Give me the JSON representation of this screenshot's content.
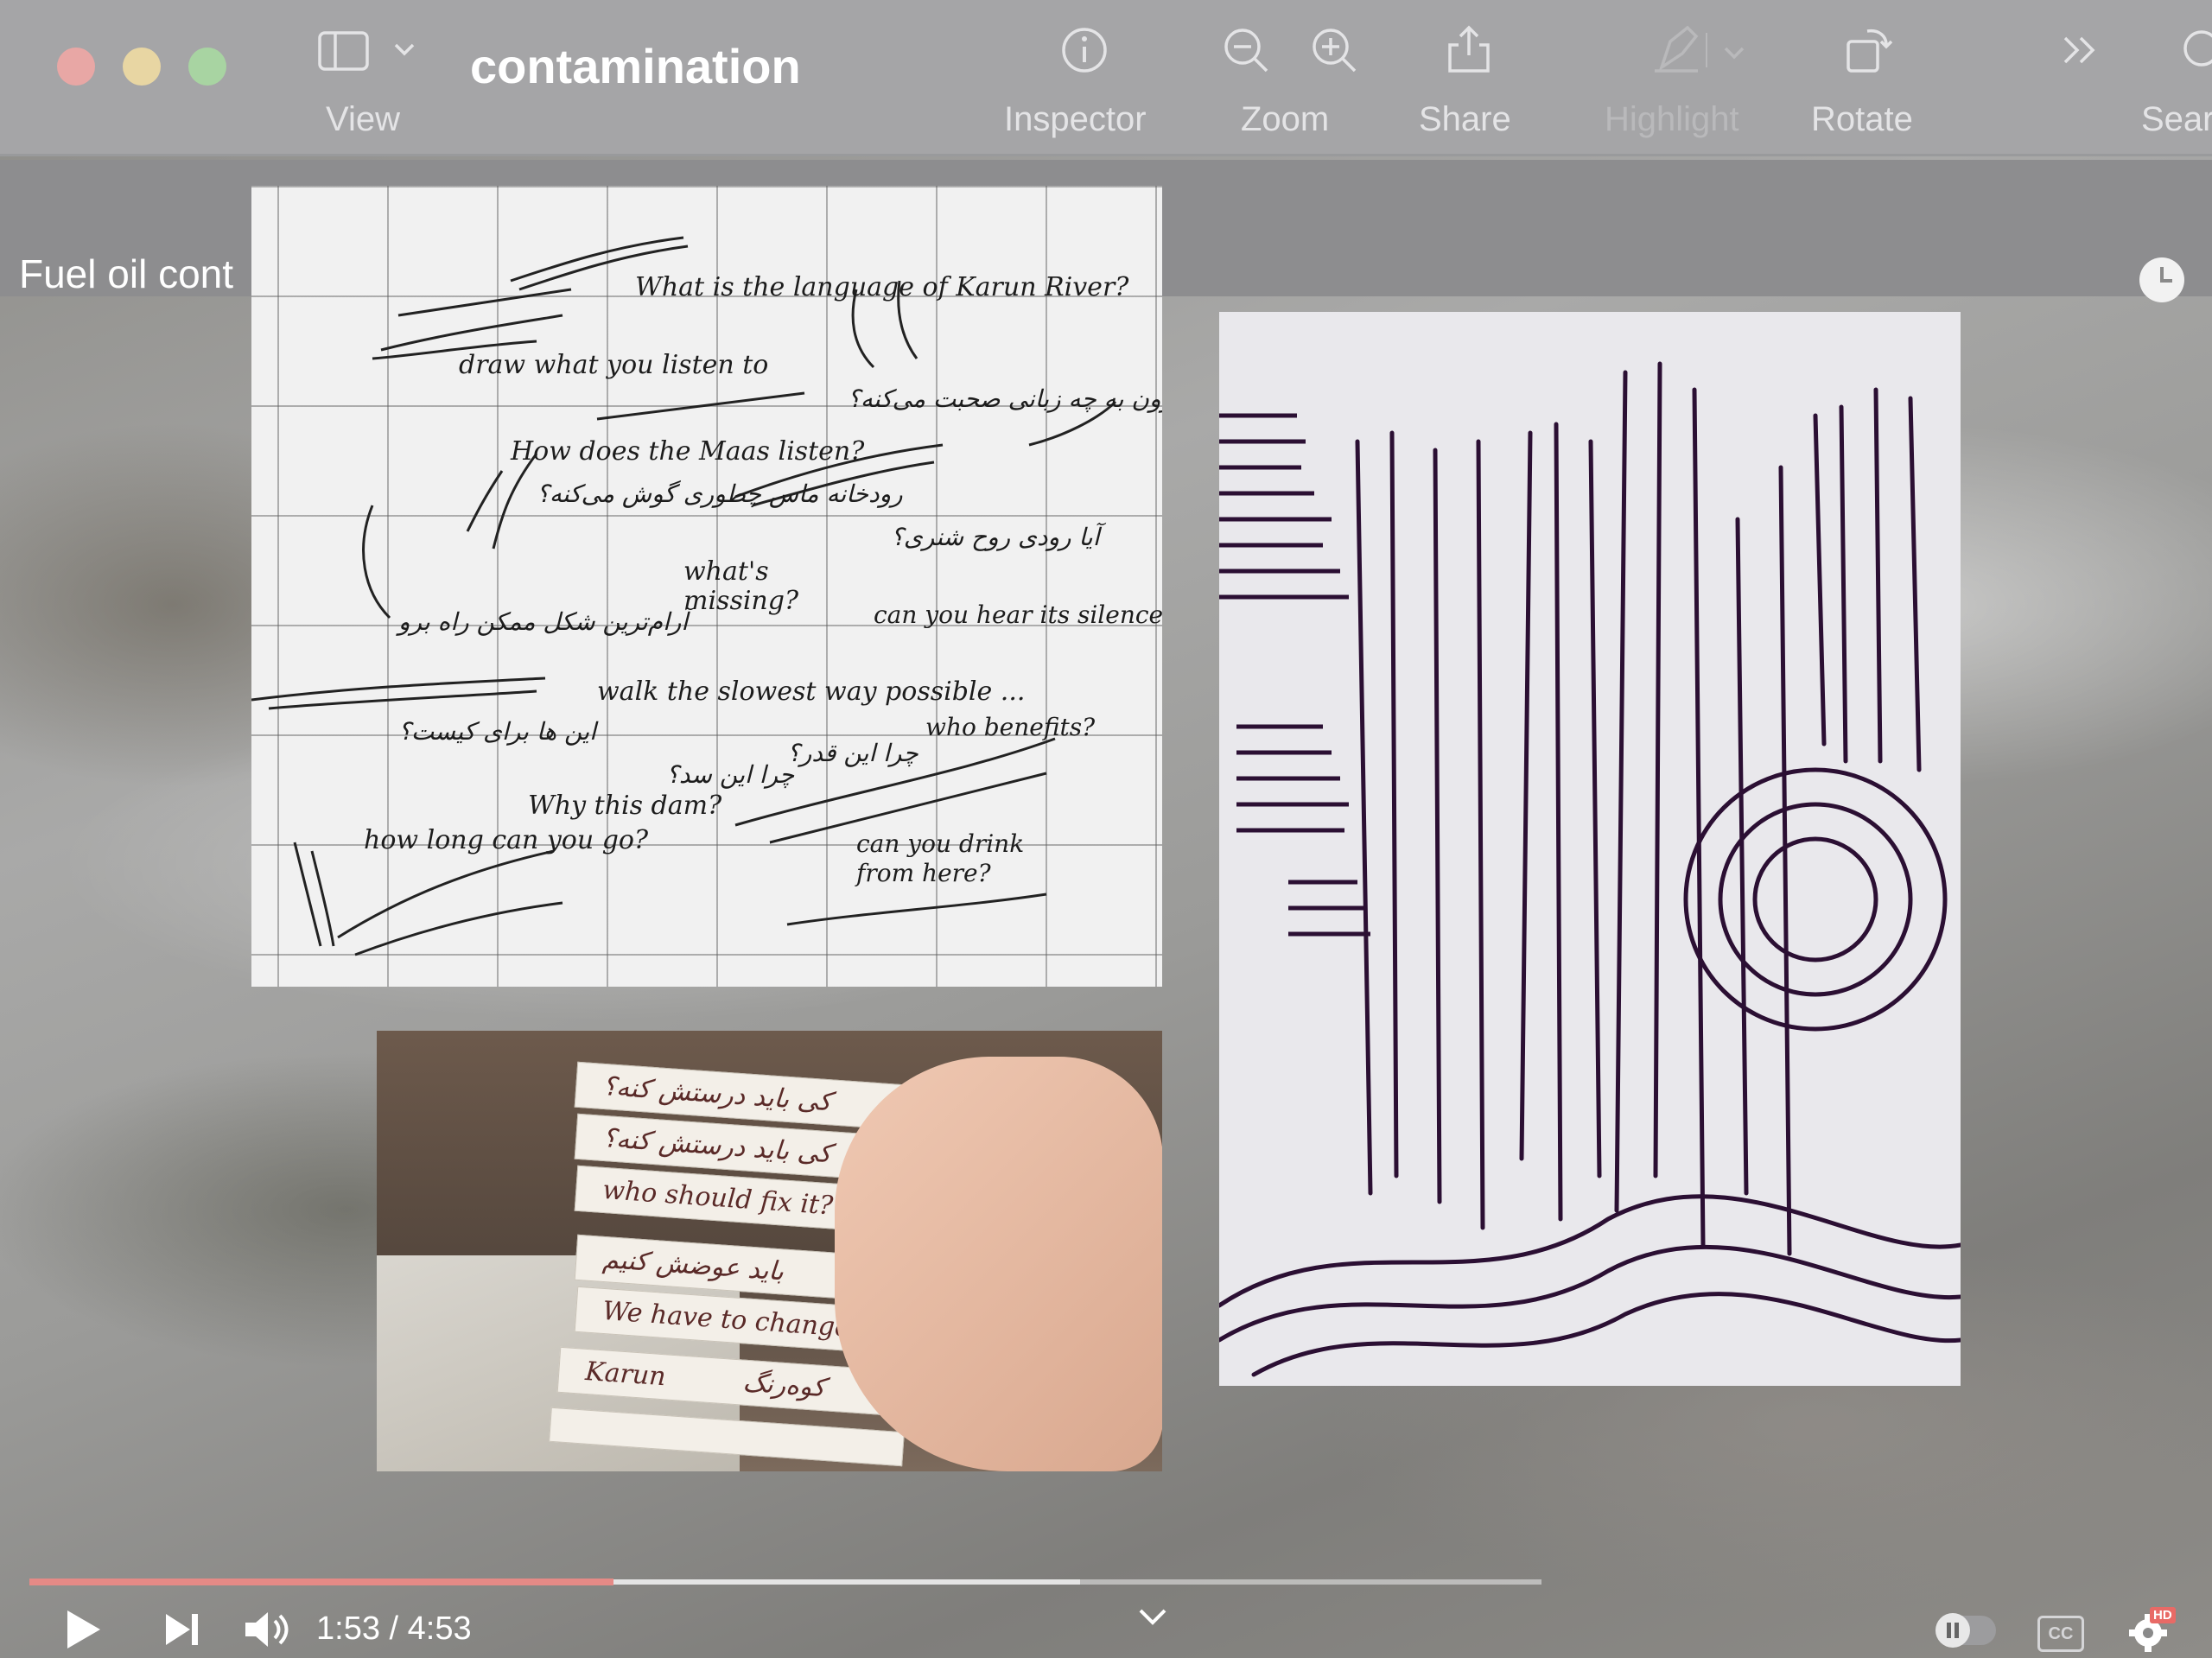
{
  "window": {
    "title": "contamination",
    "toolbar": {
      "view_label": "View",
      "inspector_label": "Inspector",
      "zoom_label": "Zoom",
      "share_label": "Share",
      "highlight_label": "Highlight",
      "rotate_label": "Rotate",
      "search_label": "Sear"
    }
  },
  "video": {
    "title": "Fuel oil cont",
    "current_time": "1:53",
    "duration": "4:53",
    "time_display": "1:53 / 4:53",
    "progress": 0.386,
    "buffered": 0.695,
    "progress_color": "#e58a86",
    "cc_label": "CC",
    "hd_badge": "HD"
  },
  "notebook_notes": [
    {
      "text": "What is the language of Karun River?"
    },
    {
      "text": "draw what you listen to"
    },
    {
      "text": "کارون به چه زبانی صحبت می‌کنه؟"
    },
    {
      "text": "How does the Maas listen?"
    },
    {
      "text": "رودخانه ماس چطوری گوش می‌کنه؟"
    },
    {
      "text": "آیا رودی روح شنری؟"
    },
    {
      "text": "what's missing?"
    },
    {
      "text": "can you hear its silence?"
    },
    {
      "text": "آرام‌ترین شکل ممکن راه برو"
    },
    {
      "text": "walk the slowest way possible ..."
    },
    {
      "text": "این ها برای کیست؟"
    },
    {
      "text": "who benefits?"
    },
    {
      "text": "چرا این سد؟"
    },
    {
      "text": "چرا این قدر؟"
    },
    {
      "text": "Why this dam?"
    },
    {
      "text": "how long can you go?"
    },
    {
      "text": "can you drink from here?"
    }
  ],
  "photo_strips": [
    {
      "text": "کی باید درستش کنه؟"
    },
    {
      "text": "who should fix it?"
    },
    {
      "text": "باید عوضش کنیم"
    },
    {
      "text": "We have to change it"
    },
    {
      "text": "Karun"
    },
    {
      "text": "کوه‌رنگ"
    }
  ]
}
